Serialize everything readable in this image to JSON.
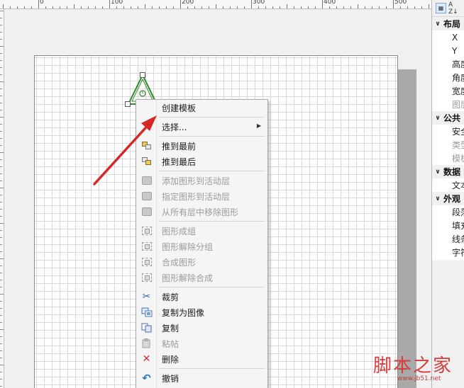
{
  "ruler": {
    "labels": [
      "0",
      "100",
      "200",
      "300",
      "400",
      "500"
    ]
  },
  "context_menu": {
    "items": [
      {
        "label": "创建模板",
        "icon": "",
        "disabled": false
      },
      {
        "label": "选择...",
        "icon": "",
        "disabled": false,
        "submenu": true
      },
      {
        "label": "推到最前",
        "icon": "bring-to-front-icon",
        "disabled": false
      },
      {
        "label": "推到最后",
        "icon": "send-to-back-icon",
        "disabled": false
      },
      {
        "label": "添加图形到活动层",
        "icon": "layer-add-icon",
        "disabled": true
      },
      {
        "label": "指定图形到活动层",
        "icon": "layer-assign-icon",
        "disabled": true
      },
      {
        "label": "从所有层中移除图形",
        "icon": "layer-remove-icon",
        "disabled": true
      },
      {
        "label": "图形成组",
        "icon": "group-icon",
        "disabled": true
      },
      {
        "label": "图形解除分组",
        "icon": "ungroup-icon",
        "disabled": true
      },
      {
        "label": "合成图形",
        "icon": "combine-icon",
        "disabled": true
      },
      {
        "label": "图形解除合成",
        "icon": "uncombine-icon",
        "disabled": true
      },
      {
        "label": "裁剪",
        "icon": "scissors-icon",
        "disabled": false
      },
      {
        "label": "复制为图像",
        "icon": "copy-as-image-icon",
        "disabled": false
      },
      {
        "label": "复制",
        "icon": "copy-icon",
        "disabled": false
      },
      {
        "label": "粘帖",
        "icon": "paste-icon",
        "disabled": true
      },
      {
        "label": "删除",
        "icon": "delete-x-icon",
        "disabled": false
      },
      {
        "label": "撤销",
        "icon": "undo-icon",
        "disabled": false
      }
    ]
  },
  "panel": {
    "toolbar": {
      "categorized_icon": "categorized-icon",
      "alpha_sort_label": "A Z↓"
    },
    "categories": [
      {
        "name": "布局",
        "props": [
          {
            "label": "X",
            "gray": false
          },
          {
            "label": "Y",
            "gray": false
          },
          {
            "label": "高度",
            "gray": false
          },
          {
            "label": "角度",
            "gray": false
          },
          {
            "label": "宽度",
            "gray": false
          },
          {
            "label": "图层",
            "gray": true
          }
        ]
      },
      {
        "name": "公共",
        "props": [
          {
            "label": "安全",
            "gray": false
          },
          {
            "label": "类型",
            "gray": true
          },
          {
            "label": "模板",
            "gray": true
          }
        ]
      },
      {
        "name": "数据",
        "props": [
          {
            "label": "文本",
            "gray": false
          }
        ]
      },
      {
        "name": "外观",
        "props": [
          {
            "label": "段落",
            "gray": false
          },
          {
            "label": "填充",
            "gray": false
          },
          {
            "label": "线条",
            "gray": false
          },
          {
            "label": "字符",
            "gray": false
          }
        ]
      }
    ]
  },
  "watermark": {
    "title": "脚本之家",
    "url": "www.jb51.net"
  },
  "colors": {
    "arrow": "#d62828",
    "shape_stroke": "#2e8b2e",
    "watermark": "#d63d3d"
  }
}
